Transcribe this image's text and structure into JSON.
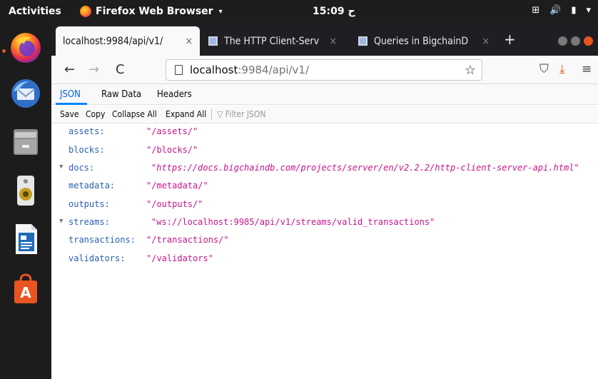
{
  "topbar": {
    "activities": "Activities",
    "app_name": "Firefox Web Browser",
    "app_caret": "▾",
    "clock": "15:09 ح",
    "tray_network": "⊞",
    "tray_volume": "🔊",
    "tray_battery": "▮",
    "tray_menu": "▾"
  },
  "dock": {
    "items": [
      "firefox",
      "thunderbird",
      "files",
      "rhythmbox",
      "libreoffice-writer",
      "ubuntu-software"
    ]
  },
  "browser": {
    "tabs": [
      {
        "label": "localhost:9984/api/v1/",
        "close": "×",
        "active": true
      },
      {
        "label": "The HTTP Client-Serv",
        "close": "×",
        "active": false
      },
      {
        "label": "Queries in BigchainD",
        "close": "×",
        "active": false
      }
    ],
    "newtab": "+",
    "nav": {
      "back": "←",
      "forward": "→",
      "reload": "C"
    },
    "url": {
      "host": "localhost",
      "path": ":9984/api/v1/",
      "star": "☆"
    },
    "toolbar": {
      "pocket": "⛉",
      "download": "⤓",
      "menu": "≡"
    }
  },
  "jsonviewer": {
    "tabs": [
      "JSON",
      "Raw Data",
      "Headers"
    ],
    "tools": [
      "Save",
      "Copy",
      "Collapse All",
      "Expand All"
    ],
    "filter_placeholder": "Filter JSON",
    "filter_icon": "▽",
    "rows": [
      {
        "key": "assets:",
        "value": "\"/assets/\"",
        "expandable": false
      },
      {
        "key": "blocks:",
        "value": "\"/blocks/\"",
        "expandable": false
      },
      {
        "key": "docs:",
        "value": "\"https://docs.bigchaindb.com/projects/server/en/v2.2.2/http-client-server-api.html\"",
        "expandable": true
      },
      {
        "key": "metadata:",
        "value": "\"/metadata/\"",
        "expandable": false
      },
      {
        "key": "outputs:",
        "value": "\"/outputs/\"",
        "expandable": false
      },
      {
        "key": "streams:",
        "value": "\"ws://localhost:9985/api/v1/streams/valid_transactions\"",
        "expandable": true
      },
      {
        "key": "transactions:",
        "value": "\"/transactions/\"",
        "expandable": false
      },
      {
        "key": "validators:",
        "value": "\"/validators\"",
        "expandable": false
      }
    ],
    "twisty": "▼"
  },
  "colors": {
    "accent": "#0a84ff",
    "json_key": "#2a5fb0",
    "json_string": "#c7148c",
    "ubuntu_orange": "#e95420"
  }
}
